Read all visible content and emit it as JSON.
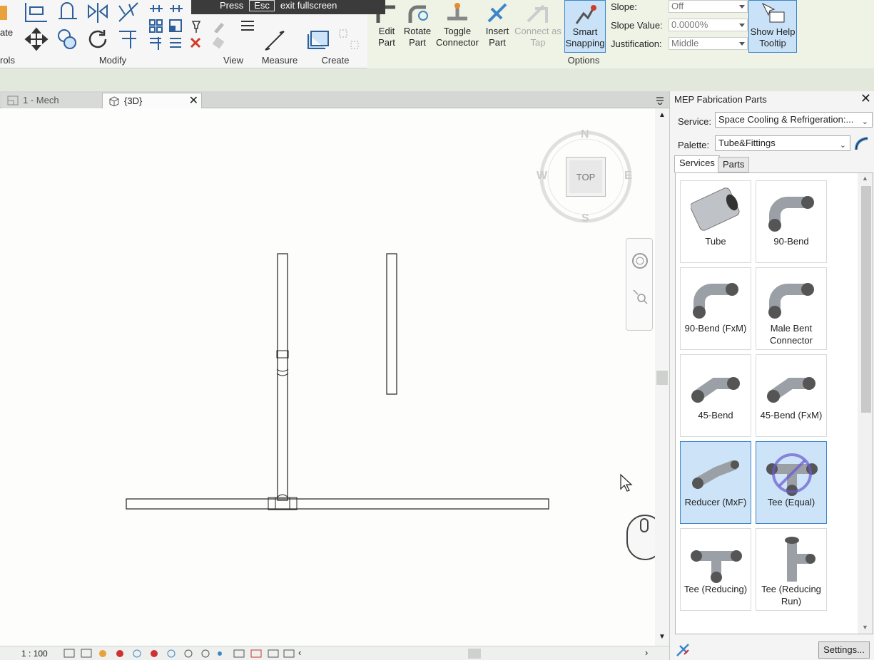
{
  "ribbon": {
    "tooltip_banner": {
      "pre": "Press",
      "key": "Esc",
      "post": "exit fullscreen"
    },
    "left_fragment": "ate",
    "panels": {
      "controls": "rols",
      "modify": "Modify",
      "view": "View",
      "measure": "Measure",
      "create": "Create",
      "options": "Options"
    },
    "buttons": {
      "edit_part": [
        "Edit",
        "Part"
      ],
      "rotate_part": [
        "Rotate",
        "Part"
      ],
      "toggle_connector": [
        "Toggle",
        "Connector"
      ],
      "insert_part": [
        "Insert",
        "Part"
      ],
      "connect_as_tap": [
        "Connect as",
        "Tap"
      ],
      "smart_snapping": [
        "Smart",
        "Snapping"
      ],
      "show_help_tooltip": [
        "Show Help",
        "Tooltip"
      ]
    },
    "options": {
      "slope_label": "Slope:",
      "slope_value": "Off",
      "slope_value_label": "Slope Value:",
      "slope_value_value": "0.0000%",
      "justification_label": "Justification:",
      "justification_value": "Middle"
    }
  },
  "tabs": [
    {
      "label": "1 - Mech"
    },
    {
      "label": "{3D}"
    }
  ],
  "viewcube": {
    "face": "TOP",
    "n": "N",
    "s": "S",
    "e": "E",
    "w": "W"
  },
  "status": {
    "scale": "1 : 100"
  },
  "fab_panel": {
    "title": "MEP Fabrication Parts",
    "service_label": "Service:",
    "service_value": "Space Cooling & Refrigeration:...",
    "palette_label": "Palette:",
    "palette_value": "Tube&Fittings",
    "tabs": [
      "Services",
      "Parts"
    ],
    "parts": [
      {
        "name": "Tube",
        "selected": false
      },
      {
        "name": "90-Bend",
        "selected": false
      },
      {
        "name": "90-Bend (FxM)",
        "selected": false
      },
      {
        "name": "Male Bent Connector",
        "selected": false
      },
      {
        "name": "45-Bend",
        "selected": false
      },
      {
        "name": "45-Bend (FxM)",
        "selected": false
      },
      {
        "name": "Reducer (MxF)",
        "selected": true
      },
      {
        "name": "Tee (Equal)",
        "selected": true
      },
      {
        "name": "Tee (Reducing)",
        "selected": false
      },
      {
        "name": "Tee (Reducing Run)",
        "selected": false
      }
    ],
    "settings_label": "Settings..."
  },
  "colors": {
    "accent": "#3d86c9",
    "selected_bg": "#cde3f8",
    "canvas": "#fdfdfb"
  }
}
